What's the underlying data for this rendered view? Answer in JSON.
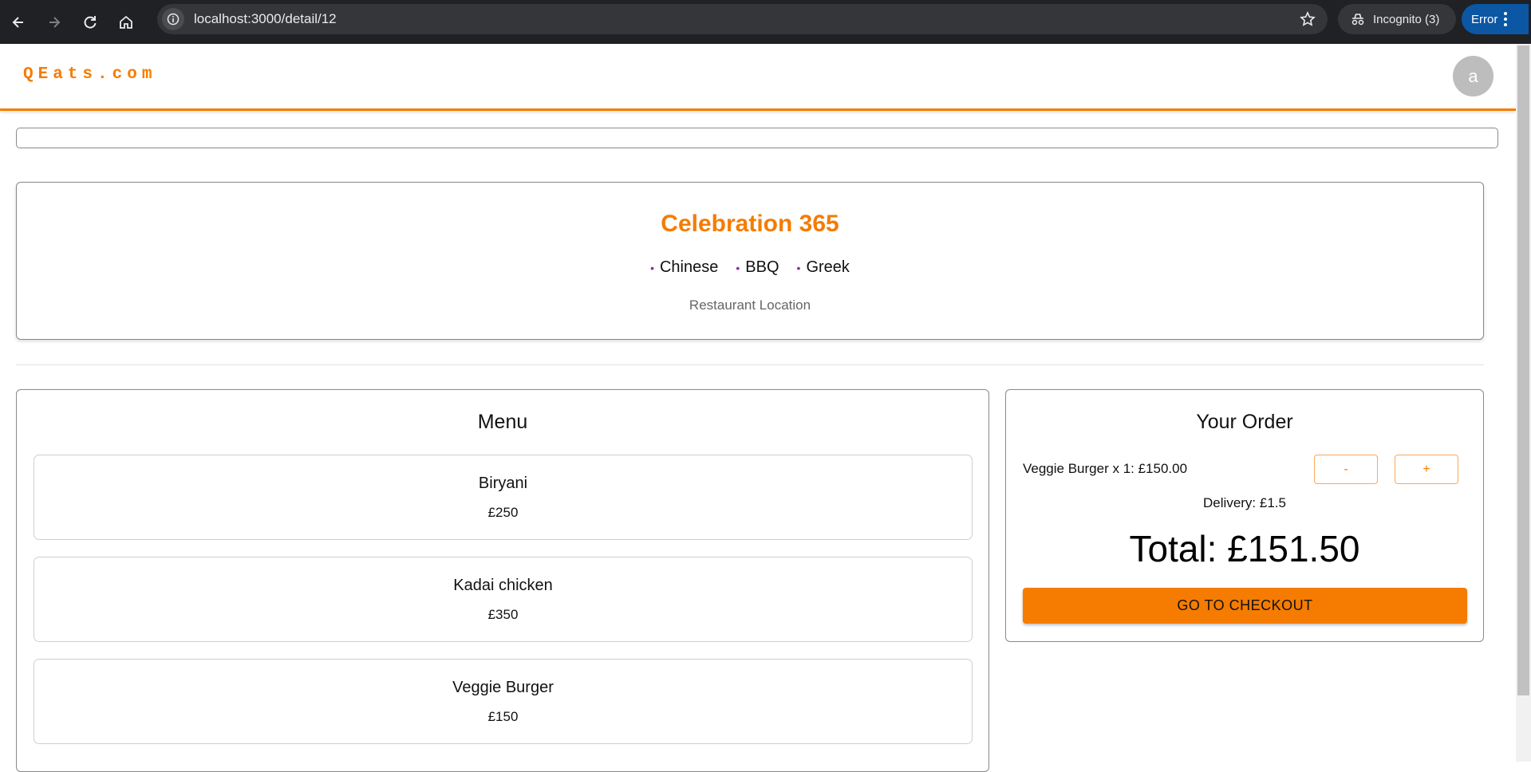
{
  "browser": {
    "url": "localhost:3000/detail/12",
    "incognito_label": "Incognito (3)",
    "error_label": "Error"
  },
  "app": {
    "logo": "QEats.com",
    "avatar_initial": "a"
  },
  "restaurant": {
    "name": "Celebration 365",
    "cuisines": [
      "Chinese",
      "BBQ",
      "Greek"
    ],
    "location": "Restaurant Location"
  },
  "menu": {
    "title": "Menu",
    "items": [
      {
        "name": "Biryani",
        "price": "£250"
      },
      {
        "name": "Kadai chicken",
        "price": "£350"
      },
      {
        "name": "Veggie Burger",
        "price": "£150"
      }
    ]
  },
  "order": {
    "title": "Your Order",
    "line": "Veggie Burger x 1: £150.00",
    "minus_label": "-",
    "plus_label": "+",
    "delivery": "Delivery: £1.5",
    "total": "Total: £151.50",
    "checkout_label": "GO TO CHECKOUT"
  },
  "colors": {
    "brand": "#f57c00",
    "cuisine_dot": "#8e24aa"
  }
}
